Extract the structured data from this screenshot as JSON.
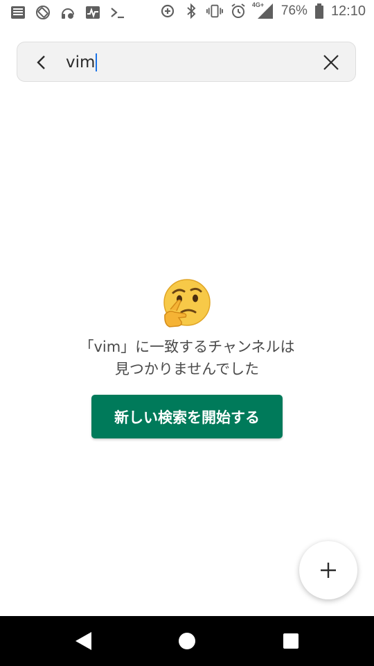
{
  "status_bar": {
    "left_icons": [
      "news-icon",
      "rotate-icon",
      "headset-icon",
      "activity-icon",
      "terminal-icon"
    ],
    "right_icons": [
      "data-saver-icon",
      "bluetooth-icon",
      "vibrate-icon",
      "alarm-icon",
      "signal-4g-icon",
      "battery-icon"
    ],
    "network_label": "4G+",
    "battery_percent": "76%",
    "time": "12:10"
  },
  "search": {
    "query": "vim",
    "back_icon": "chevron-left-icon",
    "clear_icon": "close-icon"
  },
  "empty_state": {
    "emoji": "thinking-face-icon",
    "message_line1": "「vim」に一致するチャンネルは",
    "message_line2": "見つかりませんでした",
    "button_label": "新しい検索を開始する"
  },
  "fab": {
    "icon": "plus-icon"
  },
  "navigation": {
    "buttons": [
      "back-triangle-icon",
      "home-circle-icon",
      "recents-square-icon"
    ]
  },
  "colors": {
    "primary": "#007a5a",
    "caret": "#1a73e8",
    "search_bg": "#f2f2f2"
  }
}
